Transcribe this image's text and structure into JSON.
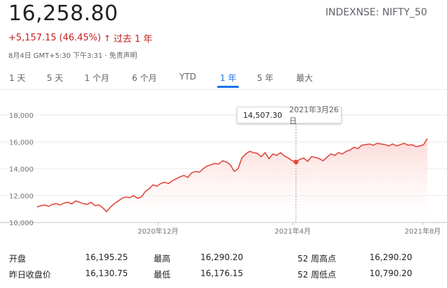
{
  "header": {
    "price": "16,258.80",
    "ticker": "INDEXNSE: NIFTY_50",
    "change_amount": "+5,157.15",
    "change_pct": "(46.45%)",
    "change_arrow": "↑",
    "period_text": "过去 1 年",
    "timestamp": "8月4日 GMT+5:30 下午3:31 · 免责声明"
  },
  "tabs": [
    {
      "label": "1 天",
      "active": false
    },
    {
      "label": "5 天",
      "active": false
    },
    {
      "label": "1 个月",
      "active": false
    },
    {
      "label": "6 个月",
      "active": false
    },
    {
      "label": "YTD",
      "active": false
    },
    {
      "label": "1 年",
      "active": true
    },
    {
      "label": "5 年",
      "active": false
    },
    {
      "label": "最大",
      "active": false
    }
  ],
  "tooltip": {
    "value": "14,507.30",
    "date": "2021年3月26日"
  },
  "colors": {
    "line": "#e04a3f",
    "fill_top": "#fbd8d5",
    "accent": "#1a73e8",
    "down": "#c5221f"
  },
  "chart_data": {
    "type": "area",
    "yticks": [
      "10,000",
      "12,000",
      "14,000",
      "16,000",
      "18,000"
    ],
    "ylim": [
      10000,
      18000
    ],
    "xticks": [
      "2020年12月",
      "2021年4月",
      "2021年8月"
    ],
    "series": [
      {
        "values": [
          11150,
          11250,
          11300,
          11200,
          11350,
          11400,
          11300,
          11450,
          11500,
          11380,
          11600,
          11500,
          11400,
          11350,
          11500,
          11250,
          11300,
          11100,
          10800,
          11150,
          11400,
          11600,
          11800,
          11900,
          11850,
          12000,
          11800,
          11900,
          12300,
          12500,
          12800,
          12700,
          12900,
          13000,
          12900,
          13100,
          13250,
          13400,
          13500,
          13350,
          13700,
          13800,
          13750,
          14000,
          14200,
          14300,
          14400,
          14350,
          14600,
          14500,
          14300,
          13800,
          14000,
          14800,
          15100,
          15300,
          15200,
          15150,
          14900,
          15200,
          14750,
          15100,
          15000,
          15200,
          14950,
          14800,
          14600,
          14507,
          14700,
          14800,
          14550,
          14900,
          14850,
          14750,
          14600,
          14850,
          15100,
          15000,
          15200,
          15100,
          15300,
          15400,
          15600,
          15500,
          15750,
          15800,
          15850,
          15750,
          15900,
          15850,
          15800,
          15700,
          15850,
          15700,
          15800,
          15900,
          15750,
          15800,
          15650,
          15700,
          15800,
          16258.8
        ]
      }
    ]
  },
  "stats": [
    {
      "label": "开盘",
      "value": "16,195.25"
    },
    {
      "label": "最高",
      "value": "16,290.20"
    },
    {
      "label": "52 周高点",
      "value": "16,290.20"
    },
    {
      "label": "昨日收盘价",
      "value": "16,130.75"
    },
    {
      "label": "最低",
      "value": "16,176.15"
    },
    {
      "label": "52 周低点",
      "value": "10,790.20"
    }
  ]
}
